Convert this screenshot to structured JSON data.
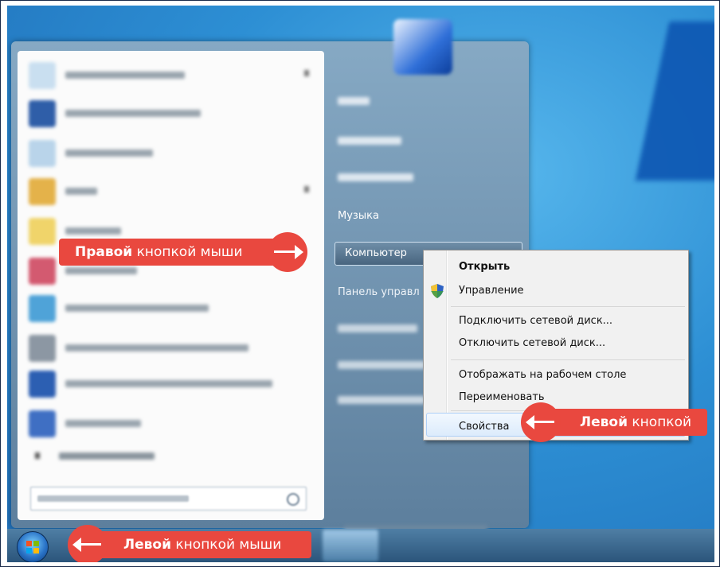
{
  "start_menu": {
    "right_items": [
      "Музыка",
      "Компьютер",
      "Панель управл"
    ],
    "computer_label": "Компьютер"
  },
  "context_menu": {
    "items": [
      "Открыть",
      "Управление",
      "Подключить сетевой диск...",
      "Отключить сетевой диск...",
      "Отображать на рабочем столе",
      "Переименовать",
      "Свойства"
    ]
  },
  "annotations": {
    "right_click": {
      "bold": "Правой",
      "rest": " кнопкой мыши"
    },
    "left_click_properties": {
      "bold": "Левой",
      "rest": " кнопкой"
    },
    "left_click_start": {
      "bold": "Левой",
      "rest": " кнопкой мыши"
    }
  },
  "colors": {
    "callout": "#e9483f",
    "desktop": "#2d8fd4",
    "menu_highlight": "#dcebfc"
  }
}
